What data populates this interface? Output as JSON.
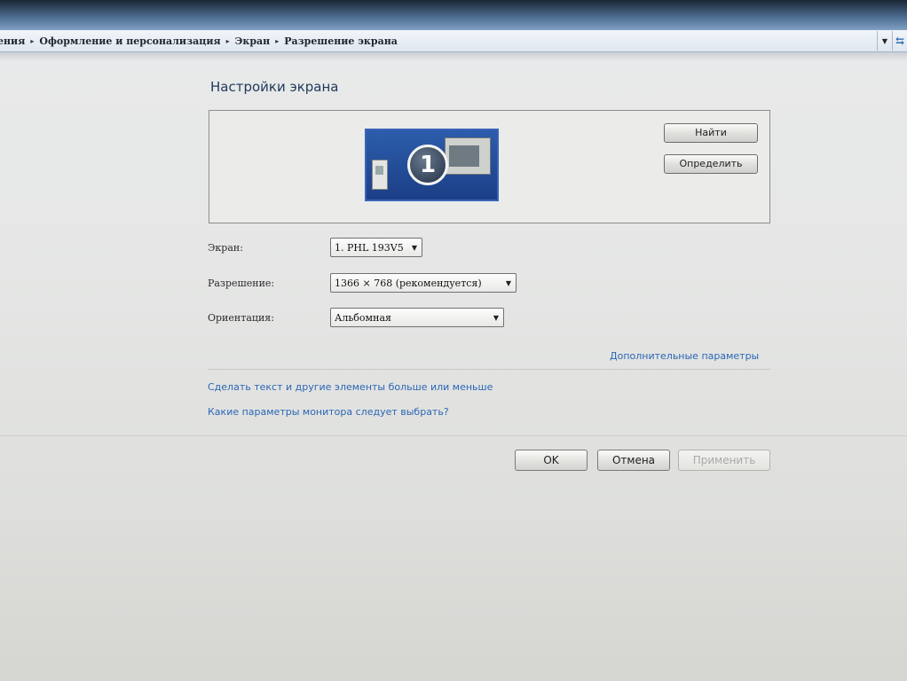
{
  "breadcrumb": {
    "items": [
      "ения",
      "Оформление и персонализация",
      "Экран",
      "Разрешение экрана"
    ],
    "separator": "▸"
  },
  "address_bar": {
    "dropdown_icon": "chevron-down-icon",
    "refresh_icon": "refresh-icon",
    "refresh_glyph": "⇆"
  },
  "title": "Настройки экрана",
  "preview": {
    "monitor_number": "1",
    "find_button": "Найти",
    "identify_button": "Определить"
  },
  "settings": {
    "display": {
      "label": "Экран:",
      "value": "1. PHL 193V5"
    },
    "resolution": {
      "label": "Разрешение:",
      "value": "1366 × 768 (рекомендуется)"
    },
    "orientation": {
      "label": "Ориентация:",
      "value": "Альбомная"
    }
  },
  "links": {
    "advanced": "Дополнительные параметры",
    "text_size": "Сделать текст и другие элементы больше или меньше",
    "which_settings": "Какие параметры монитора следует выбрать?"
  },
  "footer": {
    "ok": "OK",
    "cancel": "Отмена",
    "apply": "Применить"
  },
  "colors": {
    "link": "#2a66b5",
    "title": "#1e395b",
    "monitor_blue": "#2c5dab"
  }
}
